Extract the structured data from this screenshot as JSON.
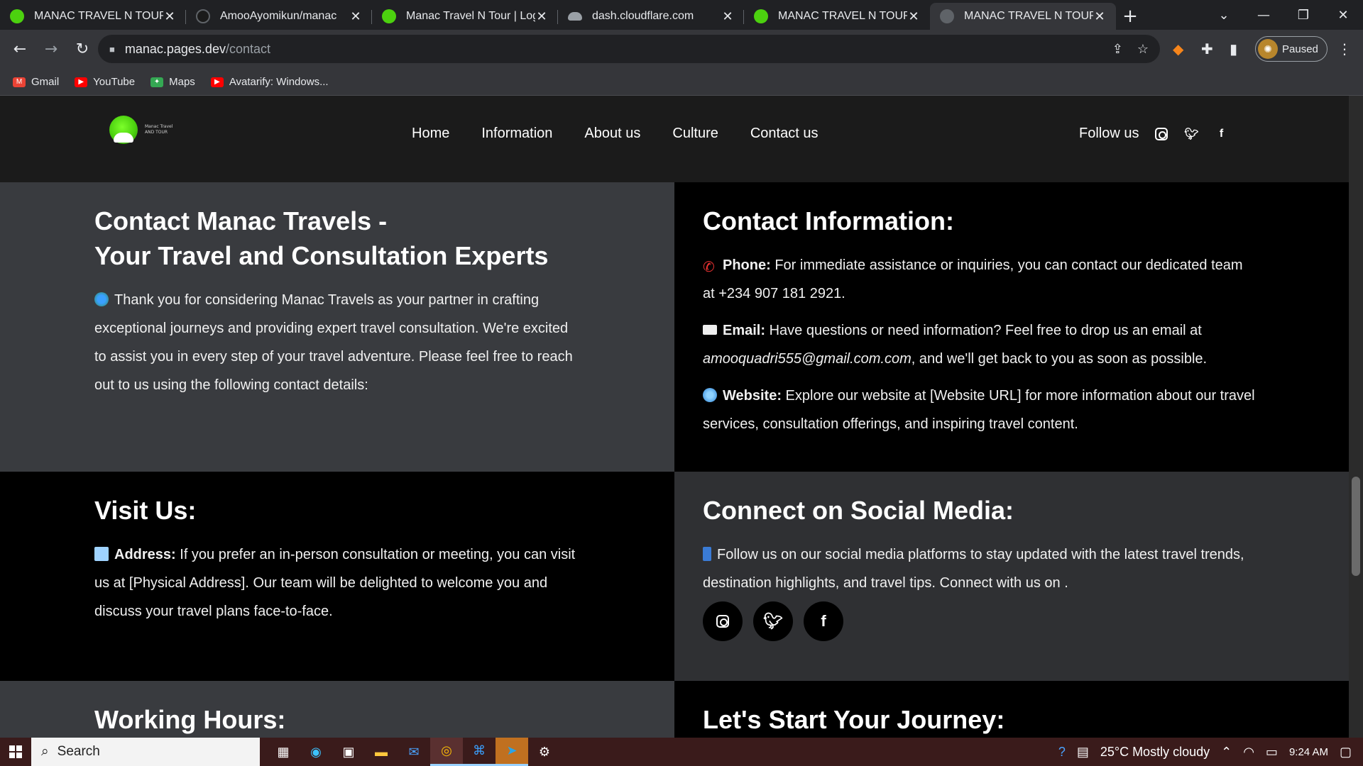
{
  "browser": {
    "tabs": [
      {
        "title": "MANAC TRAVEL N TOUR",
        "icon": "green-ball-favicon",
        "color": "#4cd10f"
      },
      {
        "title": "AmooAyomikun/manac",
        "icon": "github-favicon",
        "color": "#1b1b1b"
      },
      {
        "title": "Manac Travel N Tour | Login",
        "icon": "green-ball-favicon",
        "color": "#4cd10f"
      },
      {
        "title": "dash.cloudflare.com",
        "icon": "cloud-favicon",
        "color": "#9aa0a6"
      },
      {
        "title": "MANAC TRAVEL N TOUR",
        "icon": "green-ball-favicon",
        "color": "#4cd10f"
      },
      {
        "title": "MANAC TRAVEL N TOUR",
        "icon": "loading-favicon",
        "color": "#5f6368",
        "active": true
      }
    ],
    "url_host": "manac.pages.dev",
    "url_path": "/contact",
    "profile_label": "Paused",
    "bookmarks": [
      {
        "label": "Gmail",
        "color": "#ea4335",
        "glyph": "M"
      },
      {
        "label": "YouTube",
        "color": "#ff0000",
        "glyph": "▶"
      },
      {
        "label": "Maps",
        "color": "#34a853",
        "glyph": "✦"
      },
      {
        "label": "Avatarify: Windows...",
        "color": "#ff0000",
        "glyph": "▶"
      }
    ]
  },
  "site": {
    "brand_line1": "Manac Travel",
    "brand_line2": "AND TOUR",
    "menu": [
      "Home",
      "Information",
      "About us",
      "Culture",
      "Contact us"
    ],
    "follow_label": "Follow us",
    "follow_icons": [
      "instagram-icon",
      "twitter-icon",
      "facebook-icon"
    ]
  },
  "sections": {
    "contact": {
      "title_line1": "Contact Manac Travels -",
      "title_line2": "Your Travel and Consultation Experts",
      "body": "Thank you for considering Manac Travels as your partner in crafting exceptional journeys and providing expert travel consultation. We're excited to assist you in every step of your travel adventure. Please feel free to reach out to us using the following contact details:"
    },
    "info": {
      "title": "Contact Information:",
      "phone_label": "Phone:",
      "phone_text": "For immediate assistance or inquiries, you can contact our dedicated team at +234 907 181 2921.",
      "email_label": "Email:",
      "email_pre": "Have questions or need information? Feel free to drop us an email at",
      "email_address": "amooquadri555@gmail.com.com",
      "email_post": ", and we'll get back to you as soon as possible.",
      "website_label": "Website:",
      "website_text": "Explore our website at [Website URL] for more information about our travel services, consultation offerings, and inspiring travel content."
    },
    "visit": {
      "title": "Visit Us:",
      "address_label": "Address:",
      "address_text": "If you prefer an in-person consultation or meeting, you can visit us at [Physical Address]. Our team will be delighted to welcome you and discuss your travel plans face-to-face."
    },
    "social": {
      "title": "Connect on Social Media:",
      "body": "Follow us on our social media platforms to stay updated with the latest travel trends, destination highlights, and travel tips. Connect with us on ."
    },
    "hours": {
      "title": "Working Hours:"
    },
    "journey": {
      "title": "Let's Start Your Journey:"
    }
  },
  "taskbar": {
    "search_label": "Search",
    "weather": "25°C  Mostly cloudy",
    "time": "9:24 AM"
  },
  "colors": {
    "nav_bg": "#1b1b1b",
    "cell_gray": "#393b3f",
    "cell_dark": "#000000",
    "accent_green": "#4cd10f"
  }
}
